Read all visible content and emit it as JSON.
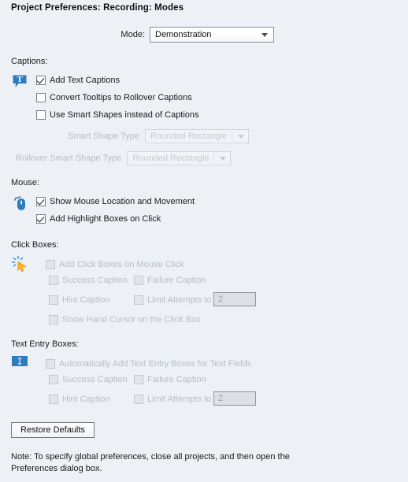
{
  "window": {
    "title": "Project Preferences: Recording: Modes"
  },
  "mode": {
    "label": "Mode:",
    "value": "Demonstration"
  },
  "captions": {
    "heading": "Captions:",
    "icon": "text-caption-balloon-icon",
    "checkboxes": [
      {
        "label": "Add Text Captions",
        "checked": true,
        "disabled": false
      },
      {
        "label": "Convert Tooltips to Rollover Captions",
        "checked": false,
        "disabled": false
      },
      {
        "label": "Use Smart Shapes instead of Captions",
        "checked": false,
        "disabled": false
      }
    ],
    "dropdowns": [
      {
        "label": "Smart Shape Type",
        "value": "Rounded Rectangle",
        "disabled": true
      },
      {
        "label": "Rollover Smart Shape Type",
        "value": "Rounded Rectangle",
        "disabled": true
      }
    ]
  },
  "mouse": {
    "heading": "Mouse:",
    "icon": "computer-mouse-icon",
    "checkboxes": [
      {
        "label": "Show Mouse Location and Movement",
        "checked": true,
        "disabled": false
      },
      {
        "label": "Add Highlight Boxes on Click",
        "checked": true,
        "disabled": false
      }
    ]
  },
  "click_boxes": {
    "heading": "Click Boxes:",
    "icon": "click-cursor-icon",
    "main": {
      "label": "Add Click Boxes on Mouse Click",
      "checked": false,
      "disabled": true
    },
    "success": {
      "label": "Success Caption",
      "checked": false,
      "disabled": true
    },
    "failure": {
      "label": "Failure Caption",
      "checked": false,
      "disabled": true
    },
    "hint": {
      "label": "Hint Caption",
      "checked": false,
      "disabled": true
    },
    "limit": {
      "label": "Limit Attempts to",
      "checked": false,
      "disabled": true
    },
    "limit_value": "2",
    "hand_cursor": {
      "label": "Show Hand Cursor on the Click Box",
      "checked": false,
      "disabled": true
    }
  },
  "text_entry_boxes": {
    "heading": "Text Entry Boxes:",
    "icon": "text-cursor-field-icon",
    "main": {
      "label": "Automatically Add Text Entry Boxes for Text Fields",
      "checked": false,
      "disabled": true
    },
    "success": {
      "label": "Success Caption",
      "checked": false,
      "disabled": true
    },
    "failure": {
      "label": "Failure Caption",
      "checked": false,
      "disabled": true
    },
    "hint": {
      "label": "Hint Caption",
      "checked": false,
      "disabled": true
    },
    "limit": {
      "label": "Limit Attempts to",
      "checked": false,
      "disabled": true
    },
    "limit_value": "2"
  },
  "footer": {
    "restore_defaults": "Restore Defaults",
    "note": "Note: To specify global preferences, close all projects, and then open the Preferences dialog box."
  },
  "colors": {
    "background": "#eef1f6",
    "accent_blue": "#2f7cc4",
    "cursor_gold": "#f3b229"
  }
}
